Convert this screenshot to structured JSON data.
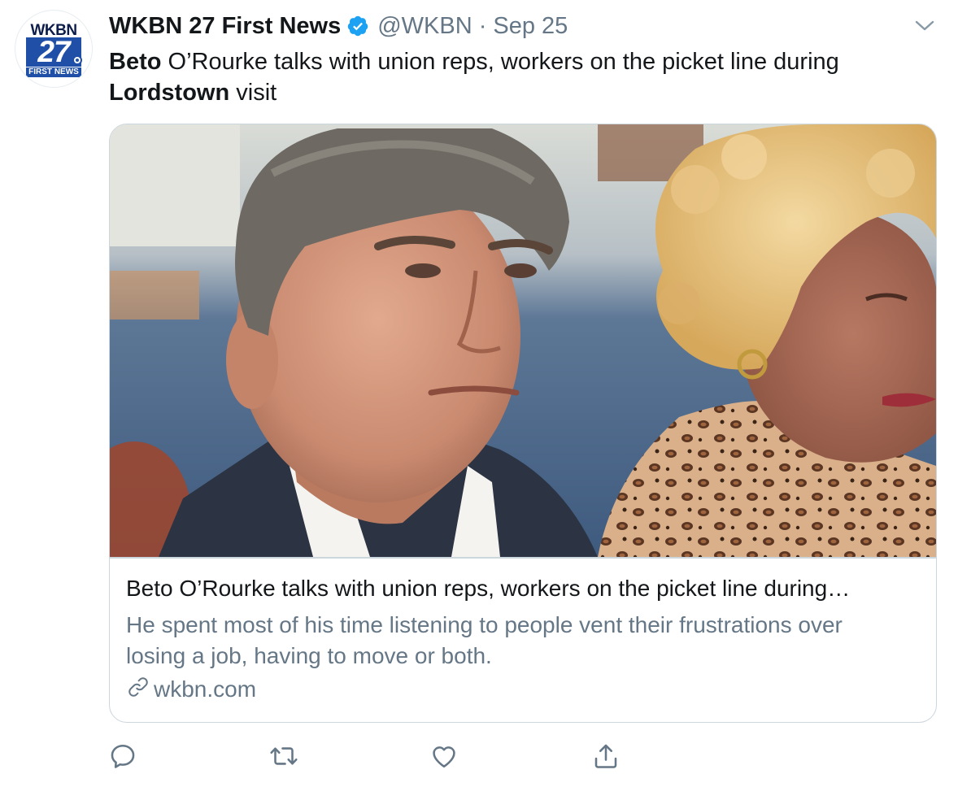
{
  "account": {
    "name": "WKBN 27 First News",
    "handle": "@WKBN",
    "separator": "·",
    "date": "Sep 25",
    "verified": true,
    "avatar_logo": {
      "top_text": "WKBN",
      "number": "27",
      "bottom_text": "FIRST NEWS"
    }
  },
  "tweet": {
    "text_bold_1": "Beto",
    "text_1": " O’Rourke talks with union reps, workers on the picket line during ",
    "text_bold_2": "Lordstown",
    "text_2": " visit"
  },
  "card": {
    "title": "Beto O’Rourke talks with union reps, workers on the picket line during…",
    "description": "He spent most of his time listening to people vent their frustrations over losing a job, having to move or both.",
    "domain": "wkbn.com"
  },
  "actions": {
    "icons": [
      "reply-icon",
      "retweet-icon",
      "like-icon",
      "share-icon"
    ]
  },
  "colors": {
    "text": "#14171a",
    "secondary": "#657786",
    "accent": "#1da1f2",
    "border": "#ccd6dd"
  }
}
